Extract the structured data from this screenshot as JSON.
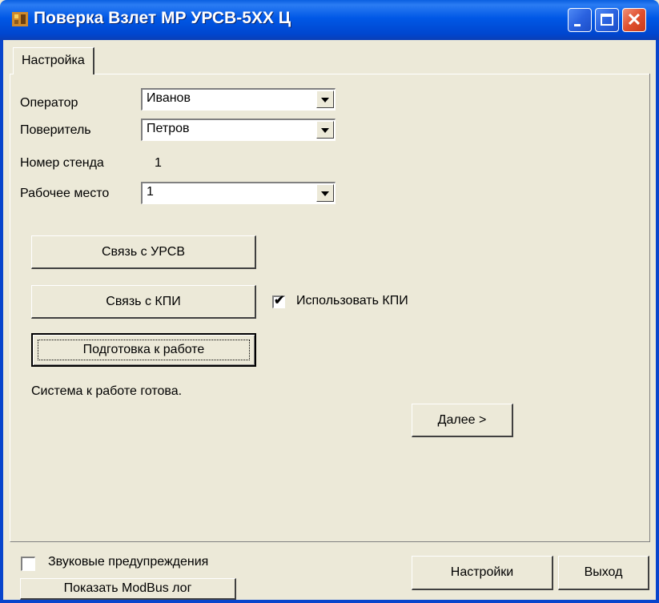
{
  "window": {
    "title": "Поверка Взлет МР УРСВ-5ХХ Ц"
  },
  "tabs": [
    {
      "label": "Настройка"
    }
  ],
  "form": {
    "operator_label": "Оператор",
    "operator_value": "Иванов",
    "verifier_label": "Поверитель",
    "verifier_value": "Петров",
    "stand_label": "Номер стенда",
    "stand_value": "1",
    "workplace_label": "Рабочее место",
    "workplace_value": "1"
  },
  "buttons": {
    "connect_ursv": "Связь с УРСВ",
    "connect_kpi": "Связь с КПИ",
    "prepare": "Подготовка к работе",
    "next": "Далее >",
    "settings": "Настройки",
    "exit": "Выход",
    "show_modbus": "Показать ModBus лог"
  },
  "use_kpi": {
    "label": "Использовать КПИ",
    "checked": true
  },
  "status_text": "Система к работе готова.",
  "sound_warnings": {
    "label": "Звуковые предупреждения",
    "checked": false
  }
}
